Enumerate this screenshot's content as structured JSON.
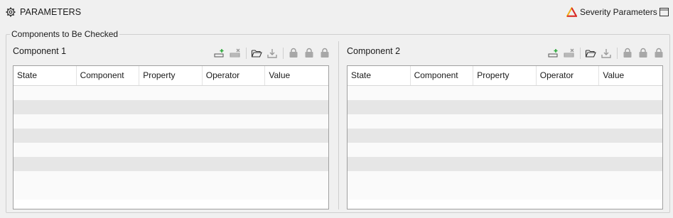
{
  "header": {
    "title": "PARAMETERS",
    "severity_label": "Severity Parameters"
  },
  "group": {
    "legend": "Components to Be Checked"
  },
  "columns": [
    "State",
    "Component",
    "Property",
    "Operator",
    "Value"
  ],
  "component1": {
    "title": "Component 1"
  },
  "component2": {
    "title": "Component 2"
  },
  "toolbar_icons": [
    "add-row-icon",
    "delete-row-icon",
    "open-folder-icon",
    "import-icon",
    "lock-icon",
    "lock-icon",
    "lock-icon"
  ],
  "colors": {
    "background": "#f0f0f0",
    "row_alt": "#e6e6e6",
    "accent_red": "#d9272e",
    "accent_yellow": "#f2b21b",
    "add_green": "#2eaa3c"
  }
}
